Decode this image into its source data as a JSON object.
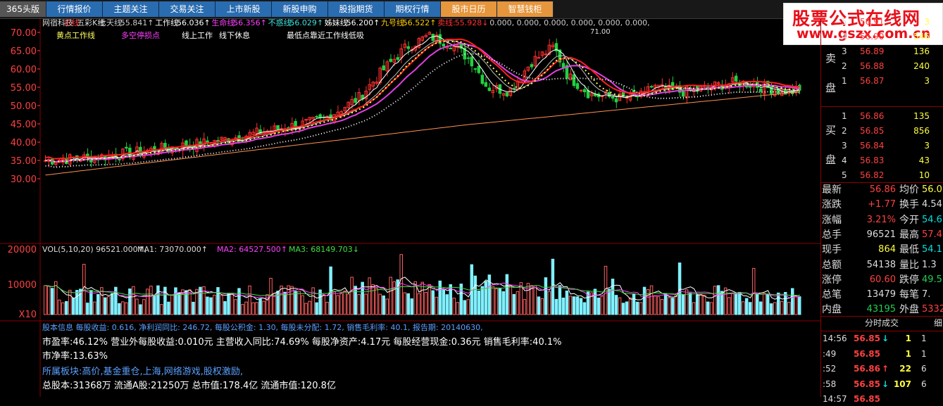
{
  "tabs": [
    {
      "label": "365头版",
      "style": "first"
    },
    {
      "label": "行情报价",
      "style": ""
    },
    {
      "label": "主题关注",
      "style": ""
    },
    {
      "label": "交易关注",
      "style": ""
    },
    {
      "label": "上市新股",
      "style": ""
    },
    {
      "label": "新股申购",
      "style": ""
    },
    {
      "label": "股指期货",
      "style": ""
    },
    {
      "label": "期权行情",
      "style": ""
    },
    {
      "label": "股市日历",
      "style": "hl"
    },
    {
      "label": "智慧钱柜",
      "style": "hl"
    }
  ],
  "watermark": {
    "line1": "股票公式在线网",
    "line2": "www.gszx.com.cn"
  },
  "chart_header": {
    "stock": "网宿科技",
    "period": "日线",
    "indicator": "五彩K线",
    "series": [
      {
        "name": "七天线:",
        "value": "55.841↑",
        "color": "#cccccc"
      },
      {
        "name": "工作线:",
        "value": "56.036↑",
        "color": "#ffffff"
      },
      {
        "name": "生命线:",
        "value": "56.356↑",
        "color": "#ff40ff"
      },
      {
        "name": "不惑线:",
        "value": "56.029↑",
        "color": "#40e0e0"
      },
      {
        "name": "姊妹线:",
        "value": "56.200↑",
        "color": "#ffffff"
      },
      {
        "name": "九号线:",
        "value": "56.522↑",
        "color": "#ffcc00"
      },
      {
        "name": "卖线:",
        "value": "55.928↓",
        "color": "#ff3030"
      },
      {
        "name": "",
        "value": "0.000, 0.000, 0.000, 0.000, 0.000, 0.000,",
        "color": "#cccccc"
      }
    ]
  },
  "chart_legend": [
    {
      "text": "黄点工作线",
      "color": "#ffff60"
    },
    {
      "text": "多空停损点",
      "color": "#ff40ff"
    },
    {
      "text": "线上工作",
      "color": "#ffffff"
    },
    {
      "text": "线下休息",
      "color": "#ffffff"
    },
    {
      "text": "最低点靠近工作线低吸",
      "color": "#ffffff"
    }
  ],
  "chart_annotation": "71.00",
  "price_axis": [
    "70.00",
    "65.00",
    "60.00",
    "55.00",
    "50.00",
    "45.00",
    "40.00",
    "35.00",
    "30.00"
  ],
  "vol_header": {
    "label": "VOL(5,10,20)",
    "value": "96521.000↑",
    "ma1": "MA1: 73070.000↑",
    "ma2": "MA2: 64527.500↑",
    "ma3": "MA3: 68149.703↓"
  },
  "vol_axis": [
    "20000",
    "10000",
    "X10"
  ],
  "info": {
    "line1": "股本信息 每股收益: 0.616, 净利润同比: 246.72, 每股公积金: 1.30, 每股未分配: 1.72, 销售毛利率: 40.1, 报告期: 20140630,",
    "line2": "市盈率:46.12%  营业外每股收益:0.010元 主营收入同比:74.69% 每股净资产:4.17元 每股经营现金:0.36元  销售毛利率:40.1%",
    "line3": "市净率:13.63%",
    "line4": "所属板块:高价,基金重仓,上海,网络游戏,股权激励,",
    "line5": "总股本:31368万  流通A股:21250万   总市值:178.4亿   流通市值:120.8亿"
  },
  "order_book": {
    "sell_label": [
      "卖",
      "盘"
    ],
    "buy_label": [
      "买",
      "盘"
    ],
    "sell": [
      {
        "n": "5",
        "p": "56.91",
        "v": "3"
      },
      {
        "n": "4",
        "p": "56.90",
        "v": "546"
      },
      {
        "n": "3",
        "p": "56.89",
        "v": "136"
      },
      {
        "n": "2",
        "p": "56.88",
        "v": "240"
      },
      {
        "n": "1",
        "p": "56.87",
        "v": "3"
      }
    ],
    "buy": [
      {
        "n": "1",
        "p": "56.86",
        "v": "135"
      },
      {
        "n": "2",
        "p": "56.85",
        "v": "856"
      },
      {
        "n": "3",
        "p": "56.84",
        "v": "3"
      },
      {
        "n": "4",
        "p": "56.83",
        "v": "43"
      },
      {
        "n": "5",
        "p": "56.82",
        "v": "10"
      }
    ]
  },
  "quote": [
    {
      "k1": "最新",
      "v1": "56.86",
      "c1": "red",
      "k2": "均价",
      "v2": "56.0",
      "c2": "yel"
    },
    {
      "k1": "涨跌",
      "v1": "+1.77",
      "c1": "red",
      "k2": "换手",
      "v2": "4.54",
      "c2": "wht"
    },
    {
      "k1": "涨幅",
      "v1": "3.21%",
      "c1": "red",
      "k2": "今开",
      "v2": "54.6",
      "c2": "cya"
    },
    {
      "k1": "总手",
      "v1": "96521",
      "c1": "wht",
      "k2": "最高",
      "v2": "57.4",
      "c2": "red"
    },
    {
      "k1": "现手",
      "v1": "864",
      "c1": "yel",
      "k2": "最低",
      "v2": "54.1",
      "c2": "cya"
    },
    {
      "k1": "总额",
      "v1": "54138",
      "c1": "wht",
      "k2": "量比",
      "v2": "1.3",
      "c2": "wht"
    },
    {
      "k1": "涨停",
      "v1": "60.60",
      "c1": "red",
      "k2": "跌停",
      "v2": "49.5",
      "c2": "grn"
    },
    {
      "k1": "总笔",
      "v1": "13479",
      "c1": "wht",
      "k2": "每笔",
      "v2": "7.",
      "c2": "wht"
    },
    {
      "k1": "内盘",
      "v1": "43195",
      "c1": "grn",
      "k2": "外盘",
      "v2": "5332",
      "c2": "red"
    }
  ],
  "ticks_header": "分时成交",
  "ticks_side": "细",
  "ticks": [
    {
      "t": "14:56",
      "p": "56.85",
      "arrow": "↓",
      "v": "1",
      "n": "1",
      "pc": "red",
      "ac": "cya"
    },
    {
      "t": ":49",
      "p": "56.85",
      "arrow": "",
      "v": "1",
      "n": "1",
      "pc": "red",
      "ac": "cya"
    },
    {
      "t": ":52",
      "p": "56.86",
      "arrow": "↑",
      "v": "22",
      "n": "6",
      "pc": "red",
      "ac": "red"
    },
    {
      "t": ":58",
      "p": "56.85",
      "arrow": "↓",
      "v": "107",
      "n": "6",
      "pc": "red",
      "ac": "cya"
    },
    {
      "t": "14:57",
      "p": "56.85",
      "arrow": "",
      "v": "",
      "n": "",
      "pc": "red",
      "ac": "cya"
    }
  ],
  "colors": {
    "up": "#ff3030",
    "down": "#20d040",
    "vol_up": "#ff6060",
    "vol_down": "#80f0ff",
    "ma_white": "#ffffff",
    "ma_pink": "#e040e0",
    "ma_red": "#ff2020",
    "ma_orange": "#ff9050",
    "dots_yellow": "#ffff60"
  }
}
